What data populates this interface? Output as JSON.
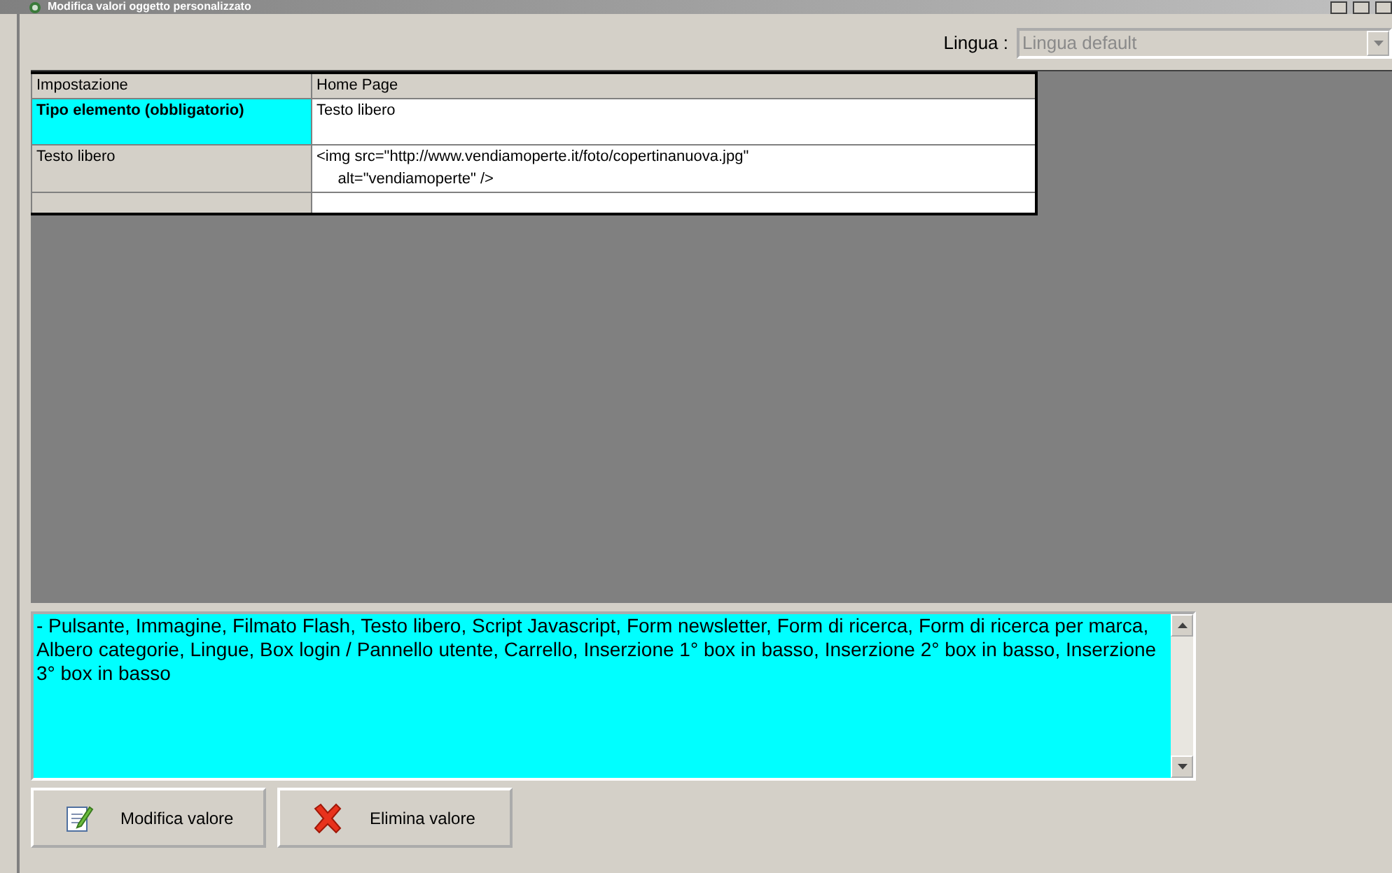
{
  "window": {
    "title": "Modifica valori oggetto personalizzato"
  },
  "language": {
    "label": "Lingua :",
    "value": "Lingua default",
    "disabled": true
  },
  "grid": {
    "columns": [
      "Impostazione",
      "Home Page"
    ],
    "rows": [
      {
        "label": "Tipo elemento (obbligatorio)",
        "value": "Testo libero",
        "selected": true
      },
      {
        "label": "Testo libero",
        "value": "<img src=\"http://www.vendiamoperte.it/foto/copertinanuova.jpg\"\n     alt=\"vendiamoperte\" />",
        "selected": false
      },
      {
        "selected": false
      }
    ]
  },
  "description": "- Pulsante, Immagine, Filmato Flash, Testo libero, Script Javascript, Form newsletter, Form di ricerca, Form di ricerca per marca, Albero categorie, Lingue, Box login / Pannello utente, Carrello, Inserzione 1° box in basso, Inserzione 2° box in basso, Inserzione 3° box in basso",
  "buttons": [
    {
      "kind": "edit",
      "label": "Modifica valore"
    },
    {
      "kind": "delete",
      "label": "Elimina valore"
    }
  ]
}
